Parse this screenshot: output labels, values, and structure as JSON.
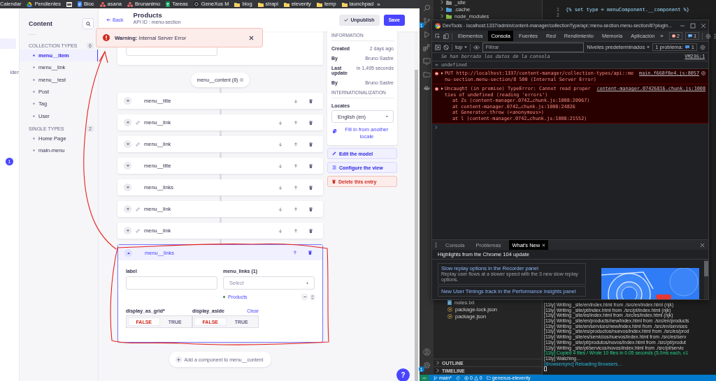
{
  "bookmarks": {
    "items": [
      {
        "label": "Calendar",
        "kind": "plain"
      },
      {
        "label": "Pendientes",
        "kind": "drive"
      },
      {
        "kind": "app"
      },
      {
        "label": "Bloc",
        "kind": "docs"
      },
      {
        "label": "asana",
        "kind": "asana"
      },
      {
        "label": "Brunanimo",
        "kind": "asana"
      },
      {
        "label": "Tareas",
        "kind": "sheets"
      },
      {
        "label": "GeneXus M",
        "kind": "genexus"
      },
      {
        "label": "blog",
        "kind": "folder"
      },
      {
        "label": "strapi",
        "kind": "folder"
      },
      {
        "label": "eleventy",
        "kind": "folder"
      },
      {
        "label": "temp",
        "kind": "folder"
      },
      {
        "label": "launchpad",
        "kind": "folder"
      }
    ],
    "more": "»"
  },
  "nav": {
    "items": [
      {
        "selected": true
      },
      {
        "label": "lder",
        "selected": false
      }
    ],
    "badge": "1"
  },
  "sidebar": {
    "title": "Content",
    "sections": [
      {
        "title": "COLLECTION TYPES",
        "count": "6",
        "items": [
          {
            "label": "menu__item",
            "selected": true
          },
          {
            "label": "menu__link",
            "selected": false
          },
          {
            "label": "menu__test",
            "selected": false
          },
          {
            "label": "Post",
            "selected": false
          },
          {
            "label": "Tag",
            "selected": false
          },
          {
            "label": "User",
            "selected": false
          }
        ]
      },
      {
        "title": "SINGLE TYPES",
        "count": "2",
        "items": [
          {
            "label": "Home Page",
            "selected": false
          },
          {
            "label": "main-menu",
            "selected": false
          }
        ]
      }
    ]
  },
  "header": {
    "back": "Back",
    "title": "Products",
    "subtitle": "API ID : menu-section",
    "buttons": [
      {
        "label": "Unpublish",
        "kind": "secondary"
      },
      {
        "label": "Save",
        "kind": "primary"
      }
    ]
  },
  "toast": {
    "text": "**Warning:** Internal Server Error"
  },
  "dynamic_zone": {
    "label": "menu__content (8)",
    "components": [
      {
        "name": "menu__title",
        "kind": "plain",
        "move_down": true,
        "move_up": false,
        "expanded": false
      },
      {
        "name": "menu__link",
        "kind": "link",
        "move_down": true,
        "move_up": true,
        "expanded": false
      },
      {
        "name": "menu__link",
        "kind": "link",
        "move_down": true,
        "move_up": true,
        "expanded": false
      },
      {
        "name": "menu__title",
        "kind": "plain",
        "move_down": true,
        "move_up": true,
        "expanded": false
      },
      {
        "name": "menu__links",
        "kind": "plain",
        "move_down": true,
        "move_up": true,
        "expanded": false
      },
      {
        "name": "menu__link",
        "kind": "link",
        "move_down": true,
        "move_up": true,
        "expanded": false
      },
      {
        "name": "menu__link",
        "kind": "link",
        "move_down": true,
        "move_up": true,
        "expanded": false
      },
      {
        "name": "menu__links",
        "kind": "plain",
        "move_down": false,
        "move_up": true,
        "expanded": true,
        "text_field": {
          "label": "label"
        },
        "relation": {
          "label": "menu_links (1)",
          "placeholder": "Select",
          "items": [
            {
              "label": "Products",
              "published": true
            }
          ]
        },
        "toggles": [
          {
            "label": "display_as_grid*",
            "options": [
              {
                "label": "FALSE",
                "selected": true
              },
              {
                "label": "TRUE",
                "selected": false
              }
            ]
          },
          {
            "label": "display_aside",
            "clear": "Clear",
            "options": [
              {
                "label": "FALSE",
                "selected": true
              },
              {
                "label": "TRUE",
                "selected": false
              }
            ]
          }
        ]
      }
    ],
    "add": "Add a component to menu__content"
  },
  "info": {
    "heading": "INFORMATION",
    "rows": [
      {
        "label": "Created",
        "value": "2 days ago"
      },
      {
        "label": "By",
        "value": "Bruno Sastre"
      },
      {
        "label": "Last update",
        "value": "in 1,495 seconds"
      },
      {
        "label": "By",
        "value": "Bruno Sastre"
      }
    ],
    "i18n_heading": "INTERNATIONALIZATION",
    "locales_label": "Locales",
    "locale": "English (en)",
    "fill_link": "Fill in from another locale"
  },
  "actions": [
    {
      "label": "Edit the model",
      "kind": "edit"
    },
    {
      "label": "Configure the view",
      "kind": "configure"
    },
    {
      "label": "Delete this entry",
      "kind": "delete"
    }
  ],
  "help": "?",
  "vscode": {
    "activity_badge": "1",
    "settings_badge": "1",
    "explorer_top": [
      {
        "name": "_site",
        "kind": "folder"
      },
      {
        "name": ".cache",
        "kind": "folder-blue"
      },
      {
        "name": "node_modules",
        "kind": "folder-green"
      }
    ],
    "explorer_bottom": [
      {
        "name": "notes.txt",
        "kind": "text"
      },
      {
        "name": "package-lock.json",
        "kind": "json"
      },
      {
        "name": "package.json",
        "kind": "json"
      }
    ],
    "panels": [
      "OUTLINE",
      "TIMELINE"
    ],
    "editor_lines": [
      {
        "number": "1",
        "code": "{% set type = menuComponent.__component %}"
      },
      {
        "number": "2"
      }
    ],
    "terminal": [
      {
        "text": "[11ty] Writing _site/en/index.html from ./src/en/index.html (njk)",
        "kind": "plain"
      },
      {
        "text": "[11ty] Writing _site/pt/index.html from ./src/pt/index.html (njk)",
        "kind": "plain"
      },
      {
        "text": "[11ty] Writing _site/es/index.html from ./src/es/index.html (njk)",
        "kind": "plain"
      },
      {
        "text": "[11ty] Writing _site/en/products/new/index.html from ./src/en/products",
        "kind": "plain"
      },
      {
        "text": "[11ty] Writing _site/en/services/new/index.html from ./src/en/services",
        "kind": "plain"
      },
      {
        "text": "[11ty] Writing _site/es/productos/nuevos/index.html from ./src/es/prod",
        "kind": "plain"
      },
      {
        "text": "[11ty] Writing _site/es/servicios/nuevos/index.html from ./src/es/serv",
        "kind": "plain"
      },
      {
        "text": "[11ty] Writing _site/pt/produtos/novos/index.html from ./src/pt/produt",
        "kind": "plain"
      },
      {
        "text": "[11ty] Writing _site/pt/servicos/novos/index.html from ./src/pt/servic",
        "kind": "plain"
      },
      {
        "text": "[11ty] Copied 4 files / Wrote 10 files in 0.05 seconds (5.0ms each, v1",
        "kind": "success"
      },
      {
        "text": "[11ty] Watching…",
        "kind": "plain"
      },
      {
        "text": "[Browsersync] Reloading Browsers...",
        "kind": "sync"
      }
    ],
    "status": {
      "branch": "main*",
      "errors": "0",
      "warnings": "0",
      "folder": "genexus-eleventy"
    }
  },
  "devtools": {
    "title": "DevTools - localhost:1337/admin/content-manager/collectionType/api::menu-section.menu-section/8?plugin...",
    "tabs": [
      {
        "label": "Elementos",
        "selected": false
      },
      {
        "label": "Consola",
        "selected": true
      },
      {
        "label": "Fuentes",
        "selected": false
      },
      {
        "label": "Red",
        "selected": false
      },
      {
        "label": "Rendimiento",
        "selected": false
      },
      {
        "label": "Memoria",
        "selected": false
      },
      {
        "label": "Aplicación",
        "selected": false
      }
    ],
    "more": "»",
    "error_count": "2",
    "message_count": "1",
    "context": "top",
    "filter_placeholder": "Filtrar",
    "levels": "Niveles predeterminados",
    "issues": "1 problema:",
    "issues_count": "1",
    "messages": [
      {
        "kind": "info",
        "text": "Se han borrado los datos de la consola",
        "source": "VM236:1"
      },
      {
        "kind": "result",
        "text": "undefined"
      },
      {
        "kind": "error",
        "text": "PUT http://localhost:1337/content-manager/collection-types/api::menu-section.menu-section/8 500 (Internal Server Error)",
        "source": "main.f668f8e4.js:8057"
      },
      {
        "kind": "error",
        "text": "Uncaught (in promise) TypeError: Cannot read properties of undefined (reading 'errors')",
        "source": "content-manager.07426816.chunk.js:1008",
        "stack": [
          "at Zs (content-manager.0742…chunk.js:1008:20967)",
          "at content-manager.0742…chunk.js:1008:24826",
          "at Generator.throw (<anonymous>)",
          "at l (content-manager.0742…chunk.js:1008:21552)"
        ]
      }
    ],
    "drawer_tabs": [
      {
        "label": "Consola",
        "selected": false
      },
      {
        "label": "Problemas",
        "selected": false
      },
      {
        "label": "What's New",
        "selected": true
      }
    ],
    "highlights": "Highlights from the Chrome 104 update",
    "cards": [
      {
        "title": "Slow replay options in the Recorder panel",
        "text": "Replay user flows at a slower speed with the 3 new slow replay options."
      },
      {
        "title": "New User Timings track in the Performance insights panel"
      }
    ]
  }
}
